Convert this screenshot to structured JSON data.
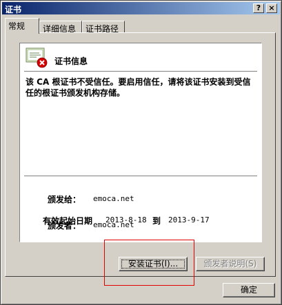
{
  "window": {
    "title": "证书",
    "help_label": "?",
    "close_label": "×"
  },
  "tabs": [
    {
      "label": "常规",
      "active": true
    },
    {
      "label": "详细信息",
      "active": false
    },
    {
      "label": "证书路径",
      "active": false
    }
  ],
  "general": {
    "heading": "证书信息",
    "warning": "该 CA 根证书不受信任。要启用信任，请将该证书安装到受信任的根证书颁发机构存储。",
    "issued_to_label": "颁发给：",
    "issued_to": "emoca.net",
    "issued_by_label": "颁发者：",
    "issued_by": "emoca.net",
    "valid_from_label": "有效起始日期",
    "valid_from": "2013-8-18",
    "to_label": "到",
    "valid_to": "2013-9-17"
  },
  "buttons": {
    "install": "安装证书(I)...",
    "issuer_statement": "颁发者说明(S)",
    "ok": "确定"
  },
  "colors": {
    "titlebar_start": "#0a246a",
    "titlebar_end": "#a6caf0",
    "highlight": "#e00000",
    "error": "#d40000"
  }
}
